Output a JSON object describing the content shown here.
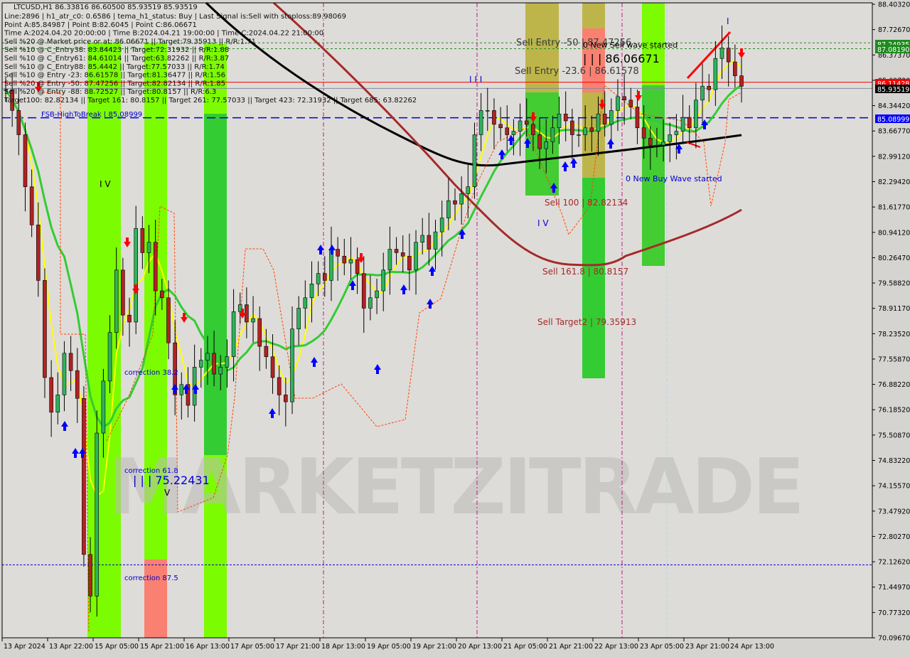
{
  "window": {
    "symbol_header": "LTCUSD,H1  86.33816 86.60500 85.93519 85.93519"
  },
  "info_panel": [
    "Line:2896 | h1_atr_c0: 0.6586 | tema_h1_status: Buy | Last Signal is:Sell with stoploss:89.98069",
    "Point A:85.84987 | Point B:82.6045 | Point C:86.06671",
    "Time A:2024.04.20 20:00:00 | Time B:2024.04.21 19:00:00 | Time C:2024.04.22 21:00:00",
    "Sell %20 @ Market price or at: 86.06671 || Target:79.35913 || R/R:1.71",
    "Sell %10 @ C_Entry38: 83.84423 || Target:72.31932 || R/R:1.88",
    "Sell %10 @ C_Entry61: 84.61014 || Target:63.82262 || R/R:3.87",
    "Sell %10 @ C_Entry88: 85.4442 || Target:77.57033 || R/R:1.74",
    "Sell %10 @ Entry -23: 86.61578 || Target:81.36477 || R/R:1.56",
    "Sell %20 @ Entry -50: 87.47256 || Target:82.82134 || R/R:1.85",
    "Sell %20 @ Entry -88: 88.72527 || Target:80.8157 || R/R:6.3",
    "Target100: 82.82134 || Target 161: 80.8157 || Target 261: 77.57033 || Target 423: 72.31932 || Target 685: 63.82262"
  ],
  "watermark": "MARKETZITRADE",
  "chart_data": {
    "type": "candlestick",
    "title": "LTCUSD,H1",
    "ohlc_header": {
      "open": 86.33816,
      "high": 86.605,
      "low": 85.93519,
      "close": 85.93519
    },
    "ylim": [
      70.0967,
      88.4032
    ],
    "y_ticks": [
      "88.40320",
      "87.72670",
      "86.37370",
      "85.69720",
      "84.34420",
      "83.66770",
      "82.99120",
      "82.29420",
      "81.61770",
      "80.94120",
      "80.26470",
      "79.58820",
      "78.91170",
      "78.23520",
      "77.55870",
      "76.88220",
      "76.18520",
      "75.50870",
      "74.83220",
      "74.15570",
      "73.47920",
      "72.80270",
      "72.12620",
      "71.44970",
      "70.77320",
      "70.09670"
    ],
    "x_ticks": [
      "13 Apr 2024",
      "13 Apr 22:00",
      "15 Apr 05:00",
      "15 Apr 21:00",
      "16 Apr 13:00",
      "17 Apr 05:00",
      "17 Apr 21:00",
      "18 Apr 13:00",
      "19 Apr 05:00",
      "19 Apr 21:00",
      "20 Apr 13:00",
      "21 Apr 05:00",
      "21 Apr 21:00",
      "22 Apr 13:00",
      "23 Apr 05:00",
      "23 Apr 21:00",
      "24 Apr 13:00"
    ],
    "price_badges": [
      {
        "value": "87.24935",
        "color": "#1e8a1e",
        "text_color": "#ffffff"
      },
      {
        "value": "87.08190",
        "color": "#1e8a1e",
        "text_color": "#ffffff"
      },
      {
        "value": "86.11428",
        "color": "#ff0000",
        "text_color": "#ffffff"
      },
      {
        "value": "85.93519",
        "color": "#000000",
        "text_color": "#ffffff"
      },
      {
        "value": "85.08999",
        "color": "#0000ff",
        "text_color": "#ffffff"
      }
    ],
    "horizontal_lines": [
      {
        "name": "sell-entry-50-line",
        "price": 87.24935,
        "color": "#1e8a1e",
        "style": "dotted"
      },
      {
        "name": "sell-entry-23-line",
        "price": 87.0819,
        "color": "#1e8a1e",
        "style": "dotted"
      },
      {
        "name": "red-level-line",
        "price": 86.11428,
        "color": "#ff0000",
        "style": "solid"
      },
      {
        "name": "bid-line",
        "price": 85.93519,
        "color": "#7f8c99",
        "style": "solid"
      },
      {
        "name": "fsb-high-to-break-line",
        "price": 85.08999,
        "color": "#0000cc",
        "style": "dashed"
      },
      {
        "name": "low-level-line",
        "price": 72.2,
        "color": "#0000cc",
        "style": "dashed-fine"
      }
    ],
    "annotations": [
      {
        "text": "FSB-HighToBreak | 85.08999",
        "color": "#0000cc"
      },
      {
        "text": "Sell Entry -50 | 87.47256",
        "color": "#3a3a3a"
      },
      {
        "text": "Sell Entry -23.6 | 86.61578",
        "color": "#3a3a3a"
      },
      {
        "text": "0 New Sell wave started",
        "color": "#000000"
      },
      {
        "text": "| | | 86.06671",
        "color": "#000000"
      },
      {
        "text": "Sell 100 | 82.82134",
        "color": "#a52a2a"
      },
      {
        "text": "Sell 161.8 | 80.8157",
        "color": "#a52a2a"
      },
      {
        "text": "Sell Target2 | 79.35913",
        "color": "#a52a2a"
      },
      {
        "text": "0 New Buy Wave started",
        "color": "#0000cc"
      },
      {
        "text": "correction 38.2",
        "color": "#0000cc"
      },
      {
        "text": "correction 61.8",
        "color": "#0000cc"
      },
      {
        "text": "| | | 75.22431",
        "color": "#0000cc"
      },
      {
        "text": "correction 87.5",
        "color": "#0000cc"
      },
      {
        "text": "I V",
        "color": "#000000"
      },
      {
        "text": "V",
        "color": "#000000"
      },
      {
        "text": "I I I",
        "color": "#0000cc"
      },
      {
        "text": "I V",
        "color": "#0000cc"
      },
      {
        "text": "I",
        "color": "#0000cc"
      }
    ],
    "zones": [
      {
        "name": "green-zone-1",
        "x_start": "15 Apr 01:00",
        "x_end": "15 Apr 10:00",
        "color": "#7cfc00"
      },
      {
        "name": "green-zone-2",
        "x_start": "15 Apr 17:00",
        "x_end": "15 Apr 23:00",
        "color": "#7cfc00"
      },
      {
        "name": "salmon-zone-2",
        "x_start": "15 Apr 17:00",
        "x_end": "15 Apr 23:00",
        "color": "#fa8072"
      },
      {
        "name": "green-zone-3",
        "x_start": "16 Apr 09:00",
        "x_end": "16 Apr 15:00",
        "color": "#7cfc00"
      },
      {
        "name": "olive-zone-sell-1",
        "x_start": "21 Apr 01:00",
        "x_end": "21 Apr 10:00",
        "color": "#bdb54a"
      },
      {
        "name": "olive-zone-sell-2",
        "x_start": "21 Apr 17:00",
        "x_end": "21 Apr 23:00",
        "color": "#bdb54a"
      },
      {
        "name": "green-zone-4",
        "x_start": "23 Apr 05:00",
        "x_end": "23 Apr 11:00",
        "color": "#7cfc00"
      }
    ],
    "series": [
      {
        "name": "yellow-ma",
        "color": "#ffff00"
      },
      {
        "name": "green-ma",
        "color": "#33cc33"
      },
      {
        "name": "black-ma",
        "color": "#000000"
      },
      {
        "name": "darkred-ma",
        "color": "#a52a2a"
      },
      {
        "name": "orange-channel",
        "color": "#ff4500"
      }
    ],
    "close_path": [
      85.9,
      85.3,
      84.6,
      83.1,
      82.0,
      80.4,
      77.6,
      76.6,
      77.1,
      78.3,
      77.8,
      77.0,
      72.5,
      71.3,
      76.0,
      77.5,
      78.9,
      80.7,
      79.4,
      79.2,
      81.9,
      81.2,
      81.5,
      80.1,
      79.9,
      78.6,
      77.1,
      77.4,
      76.8,
      77.9,
      78.1,
      78.3,
      77.7,
      77.9,
      78.2,
      79.5,
      79.7,
      79.2,
      79.3,
      78.5,
      78.2,
      77.6,
      77.1,
      76.9,
      79.0,
      79.6,
      79.9,
      80.3,
      80.6,
      80.4,
      81.3,
      81.1,
      80.9,
      81.0,
      80.6,
      79.6,
      79.9,
      80.1,
      80.7,
      81.3,
      81.2,
      81.1,
      80.7,
      81.5,
      81.7,
      81.3,
      81.8,
      82.2,
      82.7,
      82.6,
      82.9,
      83.1,
      84.6,
      85.3,
      85.3,
      84.9,
      84.8,
      84.6,
      84.7,
      85.0,
      84.9,
      84.6,
      84.2,
      84.4,
      84.8,
      85.2,
      85.0,
      84.6,
      84.6,
      84.8,
      84.7,
      85.2,
      84.9,
      85.3,
      85.7,
      85.6,
      85.4,
      84.8,
      84.5,
      84.3,
      84.3,
      84.4,
      84.6,
      84.7,
      85.1,
      84.8,
      85.6,
      86.0,
      85.9,
      86.8,
      87.1,
      86.7,
      86.3,
      86.0
    ]
  }
}
